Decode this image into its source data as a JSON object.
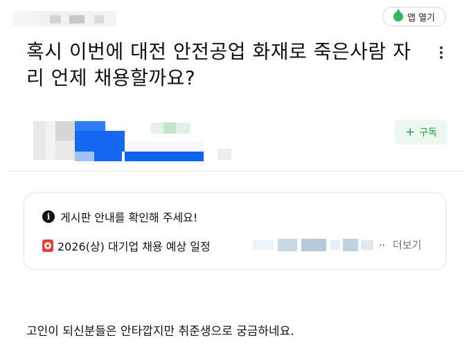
{
  "header": {
    "app_button_label": "앱 열기"
  },
  "post": {
    "title": "혹시 이번에 대전 안전공업 화재로 죽은사람 자리 언제 채용할까요?",
    "subscribe_label": "구독",
    "body": "고인이 되신분들은 안타깝지만 취준생으로 궁금하네요."
  },
  "notice": {
    "line1": "게시판 안내를 확인해 주세요!",
    "line2": "2026(상) 대기업 채용 예상 일정",
    "ellipsis": "..",
    "more_label": "더보기"
  },
  "colors": {
    "accent_green": "#1e9a45",
    "subscribe_bg": "#edf7ef",
    "calendar_red": "#e2403a"
  }
}
